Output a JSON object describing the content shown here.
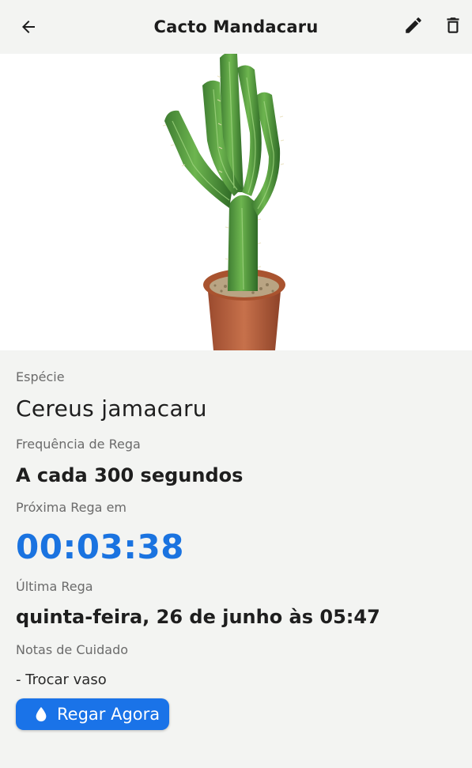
{
  "appbar": {
    "title": "Cacto Mandacaru",
    "back_icon": "arrow-back-icon",
    "edit_icon": "pencil-icon",
    "delete_icon": "trash-icon"
  },
  "plant": {
    "species_label": "Espécie",
    "species_value": "Cereus jamacaru",
    "frequency_label": "Frequência de Rega",
    "frequency_value": "A cada 300 segundos",
    "next_label": "Próxima Rega em",
    "next_value": "00:03:38",
    "last_label": "Última Rega",
    "last_value": "quinta-feira, 26 de junho às 05:47",
    "notes_label": "Notas de Cuidado",
    "notes_value": "- Trocar vaso"
  },
  "action": {
    "water_now_label": "Regar Agora",
    "water_icon": "water-drop-icon"
  },
  "colors": {
    "accent": "#1a73e8",
    "timer": "#1a73e0",
    "background": "#f3f4f2"
  }
}
